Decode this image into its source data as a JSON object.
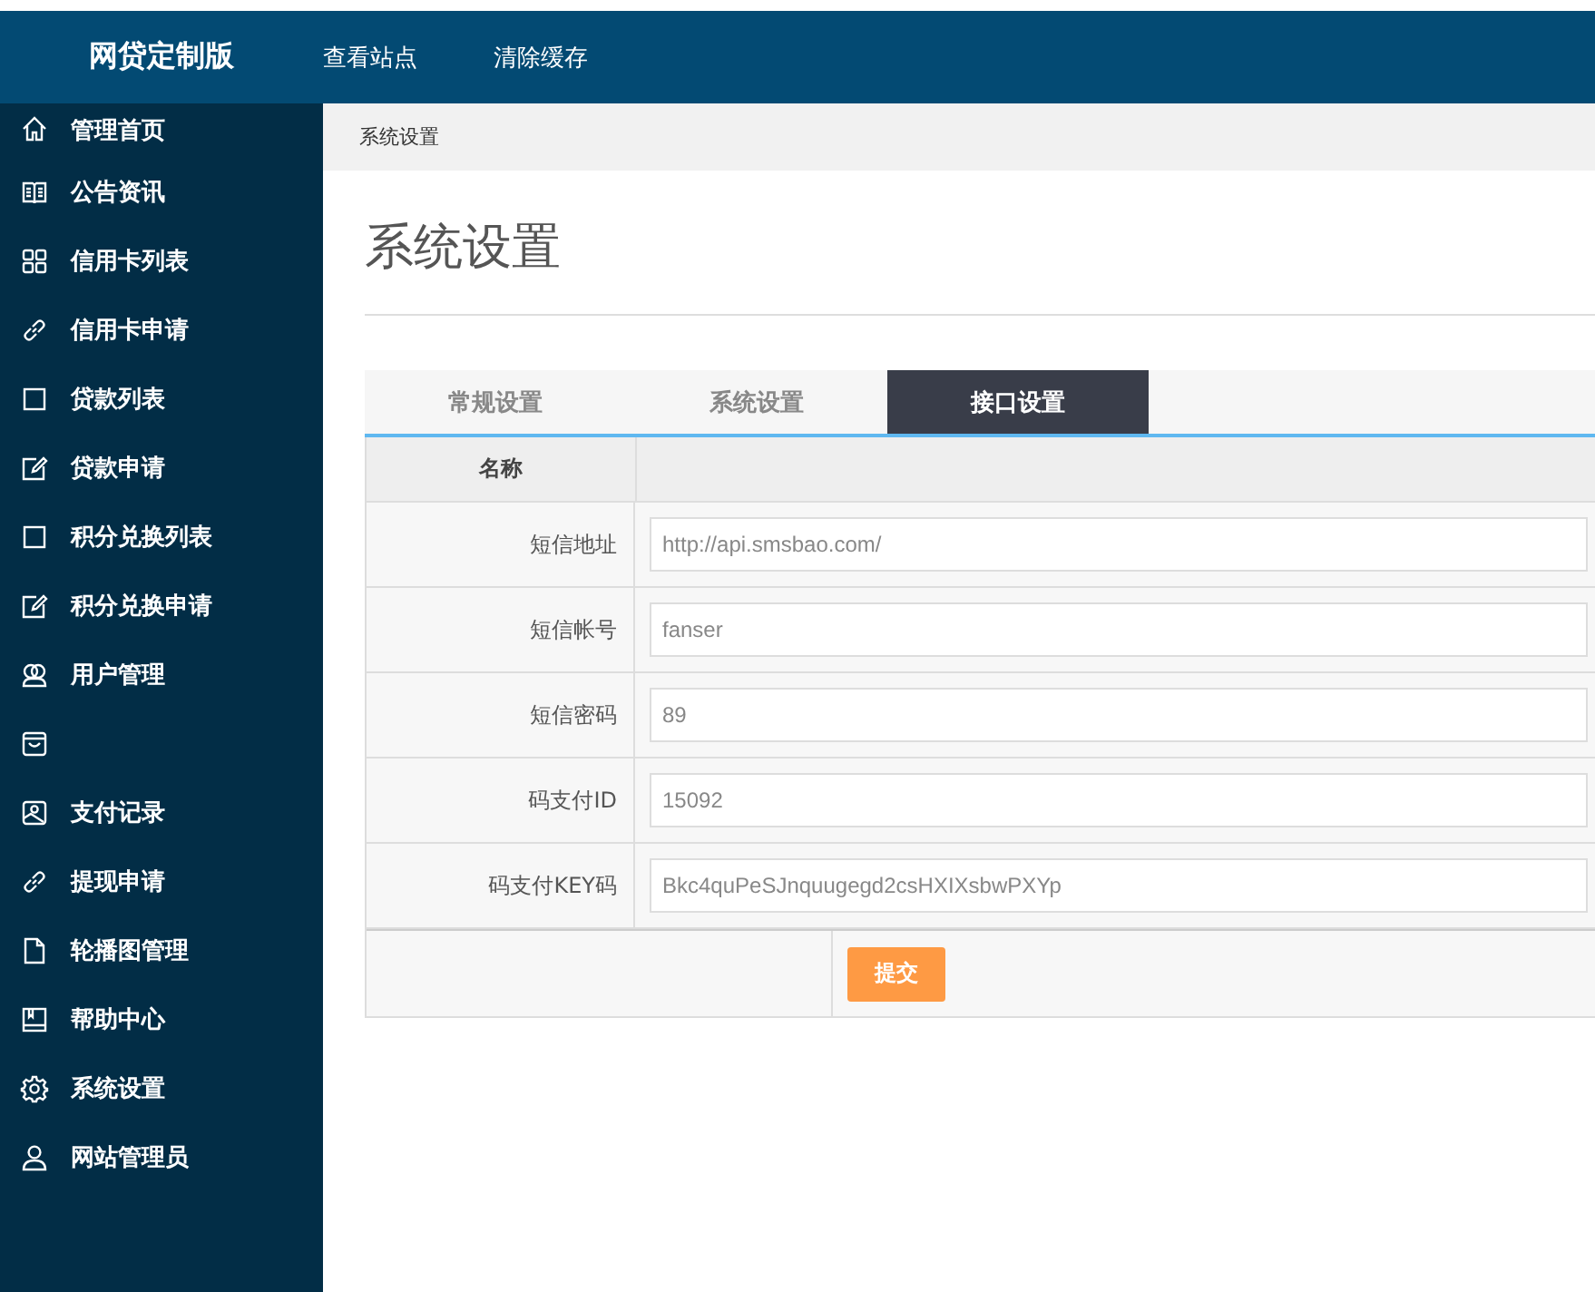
{
  "header": {
    "brand": "网贷定制版",
    "links": [
      "查看站点",
      "清除缓存"
    ]
  },
  "sidebar": {
    "items": [
      {
        "label": "管理首页",
        "kind": "home"
      },
      {
        "label": "公告资讯",
        "kind": "book"
      },
      {
        "label": "信用卡列表",
        "kind": "grid"
      },
      {
        "label": "信用卡申请",
        "kind": "link"
      },
      {
        "label": "贷款列表",
        "kind": "square"
      },
      {
        "label": "贷款申请",
        "kind": "edit"
      },
      {
        "label": "积分兑换列表",
        "kind": "square"
      },
      {
        "label": "积分兑换申请",
        "kind": "edit"
      },
      {
        "label": "用户管理",
        "kind": "users"
      },
      {
        "kind": "inbox"
      },
      {
        "label": "支付记录",
        "kind": "image"
      },
      {
        "label": "提现申请",
        "kind": "link"
      },
      {
        "label": "轮播图管理",
        "kind": "file"
      },
      {
        "label": "帮助中心",
        "kind": "manual"
      },
      {
        "label": "系统设置",
        "kind": "gear"
      },
      {
        "label": "网站管理员",
        "kind": "user"
      }
    ]
  },
  "breadcrumb": "系统设置",
  "page_title": "系统设置",
  "tabs": [
    {
      "label": "常规设置",
      "selected": false
    },
    {
      "label": "系统设置",
      "selected": false
    },
    {
      "label": "接口设置",
      "selected": true
    }
  ],
  "table": {
    "header": "名称",
    "rows": [
      {
        "label": "短信地址",
        "value": "http://api.smsbao.com/"
      },
      {
        "label": "短信帐号",
        "value": "fanser"
      },
      {
        "label": "短信密码",
        "value": "89"
      },
      {
        "label": "码支付ID",
        "value": "15092"
      },
      {
        "label": "码支付KEY码",
        "value": "Bkc4quPeSJnquugegd2csHXIXsbwPXYp"
      }
    ]
  },
  "submit": "提交"
}
